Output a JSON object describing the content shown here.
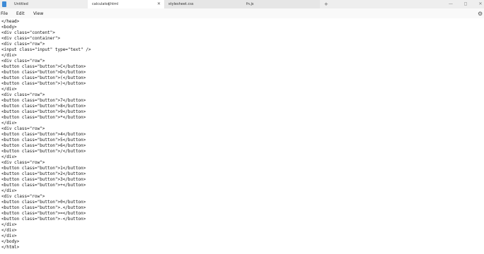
{
  "tabs": [
    {
      "label": "Untitled",
      "close": ""
    },
    {
      "label": "calculator.html",
      "close": "✕"
    },
    {
      "label": "stylesheet.css",
      "close": ""
    },
    {
      "label": "fn.js",
      "close": ""
    }
  ],
  "new_tab": "+",
  "window_controls": {
    "minimize": "—",
    "maximize": "◻",
    "close": "✕"
  },
  "menu": {
    "file": "File",
    "edit": "Edit",
    "view": "View"
  },
  "icons": {
    "settings": "⚙",
    "app": "notepad-icon"
  },
  "code_lines": [
    "</head>",
    "<body>",
    "<div class=\"content\">",
    "<div class=\"container\">",
    "<div class=\"row\">",
    "<input class=\"input\" type=\"text\" />",
    "</div>",
    "<div class=\"row\">",
    "<button class=\"button\">C</button>",
    "<button class=\"button\">D</button>",
    "<button class=\"button\">(</button>",
    "<button class=\"button\">)</button>",
    "</div>",
    "<div class=\"row\">",
    "<button class=\"button\">7</button>",
    "<button class=\"button\">8</button>",
    "<button class=\"button\">9</button>",
    "<button class=\"button\">*</button>",
    "</div>",
    "<div class=\"row\">",
    "<button class=\"button\">4</button>",
    "<button class=\"button\">5</button>",
    "<button class=\"button\">6</button>",
    "<button class=\"button\">/</button>",
    "</div>",
    "<div class=\"row\">",
    "<button class=\"button\">1</button>",
    "<button class=\"button\">2</button>",
    "<button class=\"button\">3</button>",
    "<button class=\"button\">+</button>",
    "</div>",
    "<div class=\"row\">",
    "<button class=\"button\">0</button>",
    "<button class=\"button\">.</button>",
    "<button class=\"button\">=</button>",
    "<button class=\"button\">-</button>",
    "</div>",
    "</div>",
    "</div>",
    "</body>",
    "</html>"
  ]
}
